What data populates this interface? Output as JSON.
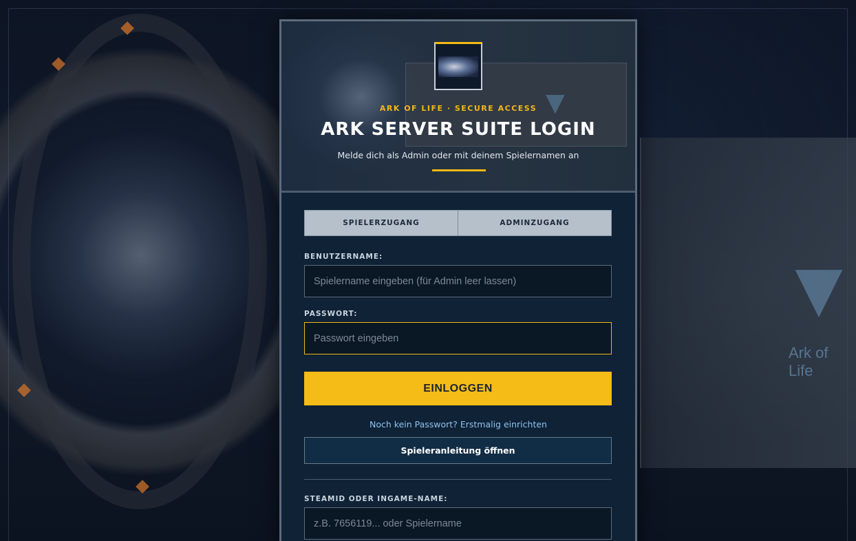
{
  "background": {
    "ship_label": "Ark of Life"
  },
  "header": {
    "eyebrow": "ARK OF LIFE · SECURE ACCESS",
    "title": "ARK SERVER SUITE LOGIN",
    "subtitle": "Melde dich als Admin oder mit deinem Spielernamen an"
  },
  "tabs": [
    {
      "label": "SPIELERZUGANG"
    },
    {
      "label": "ADMINZUGANG"
    }
  ],
  "form": {
    "username_label": "BENUTZERNAME:",
    "username_placeholder": "Spielername eingeben (für Admin leer lassen)",
    "username_value": "",
    "password_label": "PASSWORT:",
    "password_placeholder": "Passwort eingeben",
    "password_value": "",
    "login_button": "EINLOGGEN",
    "setup_link": "Noch kein Passwort? Erstmalig einrichten",
    "guide_button": "Spieleranleitung öffnen",
    "steam_label": "STEAMID ODER INGAME-NAME:",
    "steam_placeholder": "z.B. 7656119... oder Spielername",
    "steam_value": ""
  },
  "colors": {
    "accent": "#f5bb17",
    "panel": "#0f2236",
    "link": "#8fc2f0",
    "tab_bg": "#b6c0cb"
  }
}
